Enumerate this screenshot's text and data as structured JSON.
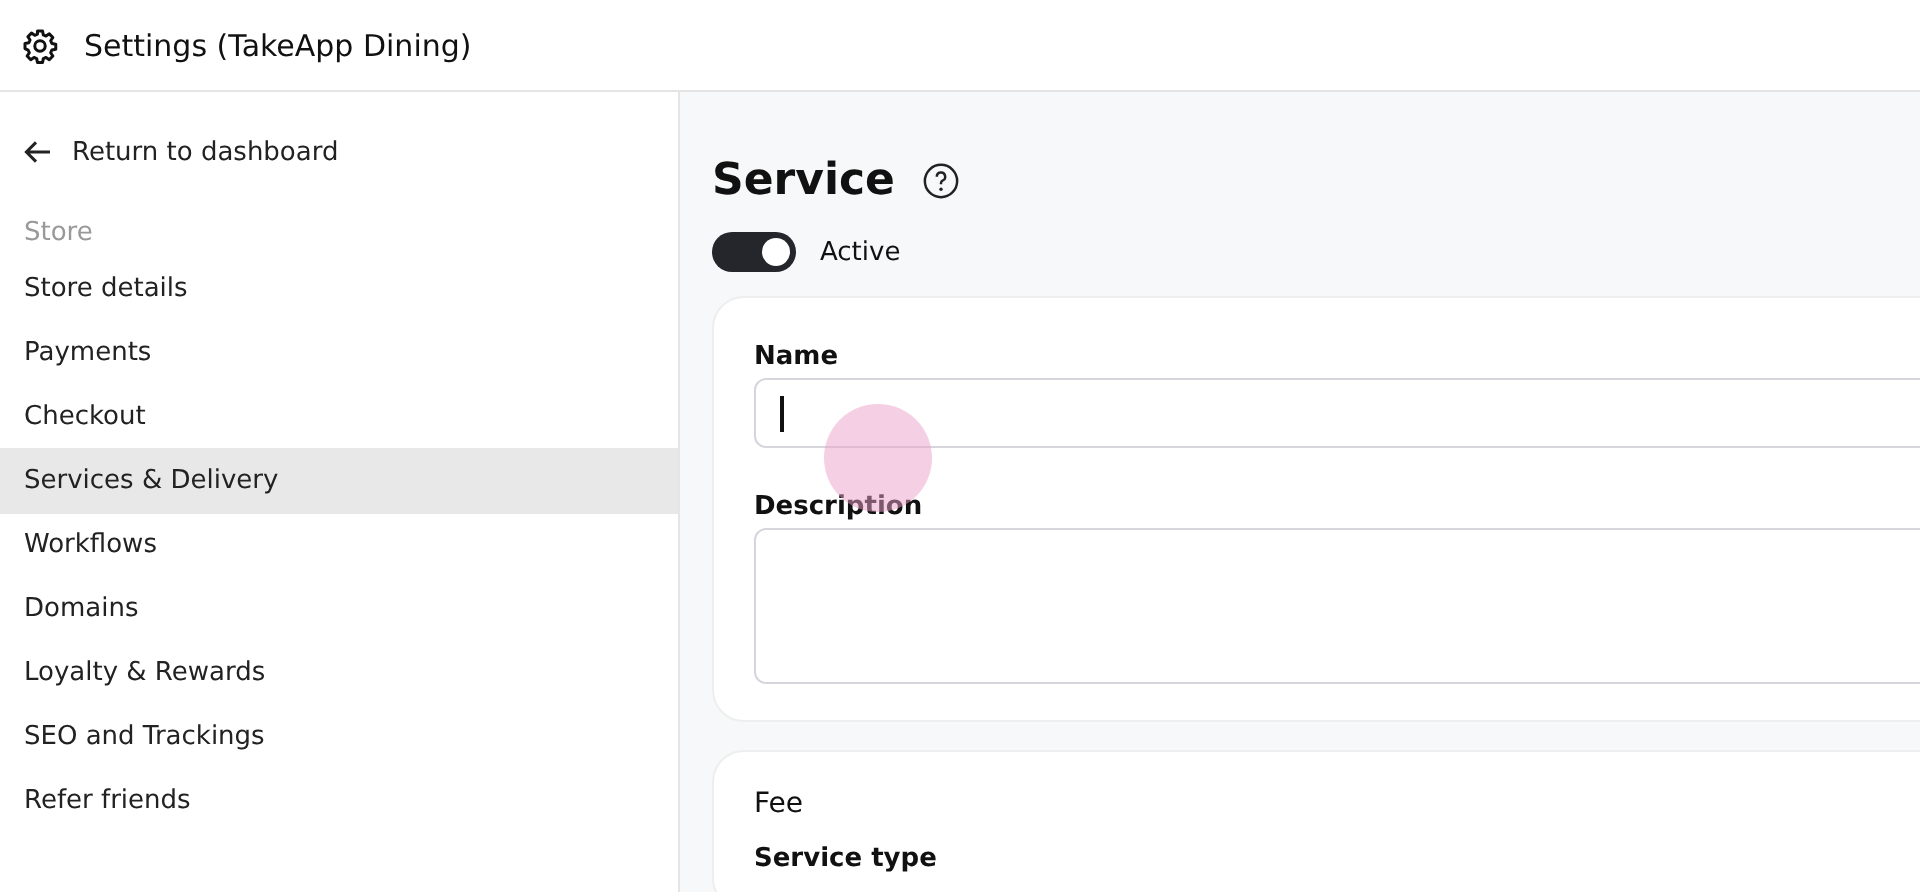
{
  "header": {
    "title": "Settings (TakeApp Dining)"
  },
  "sidebar": {
    "back_link": "Return to dashboard",
    "section": "Store",
    "items": [
      {
        "label": "Store details",
        "selected": false
      },
      {
        "label": "Payments",
        "selected": false
      },
      {
        "label": "Checkout",
        "selected": false
      },
      {
        "label": "Services & Delivery",
        "selected": true
      },
      {
        "label": "Workflows",
        "selected": false
      },
      {
        "label": "Domains",
        "selected": false
      },
      {
        "label": "Loyalty & Rewards",
        "selected": false
      },
      {
        "label": "SEO and Trackings",
        "selected": false
      },
      {
        "label": "Refer friends",
        "selected": false
      }
    ]
  },
  "main": {
    "title": "Service",
    "toggle": {
      "label": "Active",
      "on": true
    },
    "fields": [
      {
        "kind": "input",
        "label": "Name"
      },
      {
        "kind": "textarea",
        "label": "Description"
      }
    ],
    "fee": {
      "title": "Fee",
      "field_label": "Service type"
    }
  }
}
